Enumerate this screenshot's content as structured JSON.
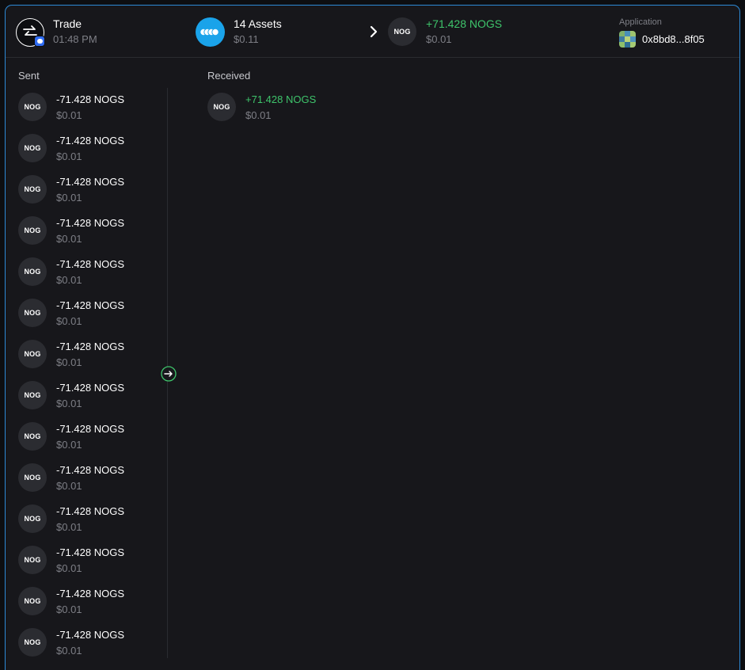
{
  "header": {
    "trade": {
      "title": "Trade",
      "time": "01:48 PM",
      "icon": "swap-icon",
      "badge": "network-badge-icon"
    },
    "assets": {
      "title": "14 Assets",
      "value": "$0.11",
      "icon_color": "#1aa3ea"
    },
    "received": {
      "token": "NOG",
      "amount": "+71.428 NOGS",
      "value": "$0.01"
    },
    "application": {
      "label": "Application",
      "address": "0x8bd8...8f05"
    }
  },
  "sent": {
    "label": "Sent",
    "items": [
      {
        "token": "NOG",
        "amount": "-71.428 NOGS",
        "value": "$0.01"
      },
      {
        "token": "NOG",
        "amount": "-71.428 NOGS",
        "value": "$0.01"
      },
      {
        "token": "NOG",
        "amount": "-71.428 NOGS",
        "value": "$0.01"
      },
      {
        "token": "NOG",
        "amount": "-71.428 NOGS",
        "value": "$0.01"
      },
      {
        "token": "NOG",
        "amount": "-71.428 NOGS",
        "value": "$0.01"
      },
      {
        "token": "NOG",
        "amount": "-71.428 NOGS",
        "value": "$0.01"
      },
      {
        "token": "NOG",
        "amount": "-71.428 NOGS",
        "value": "$0.01"
      },
      {
        "token": "NOG",
        "amount": "-71.428 NOGS",
        "value": "$0.01"
      },
      {
        "token": "NOG",
        "amount": "-71.428 NOGS",
        "value": "$0.01"
      },
      {
        "token": "NOG",
        "amount": "-71.428 NOGS",
        "value": "$0.01"
      },
      {
        "token": "NOG",
        "amount": "-71.428 NOGS",
        "value": "$0.01"
      },
      {
        "token": "NOG",
        "amount": "-71.428 NOGS",
        "value": "$0.01"
      },
      {
        "token": "NOG",
        "amount": "-71.428 NOGS",
        "value": "$0.01"
      },
      {
        "token": "NOG",
        "amount": "-71.428 NOGS",
        "value": "$0.01"
      }
    ]
  },
  "received": {
    "label": "Received",
    "items": [
      {
        "token": "NOG",
        "amount": "+71.428 NOGS",
        "value": "$0.01"
      }
    ]
  },
  "colors": {
    "accent_border": "#2d8ad6",
    "positive": "#3ec46b",
    "background": "#17171b"
  }
}
